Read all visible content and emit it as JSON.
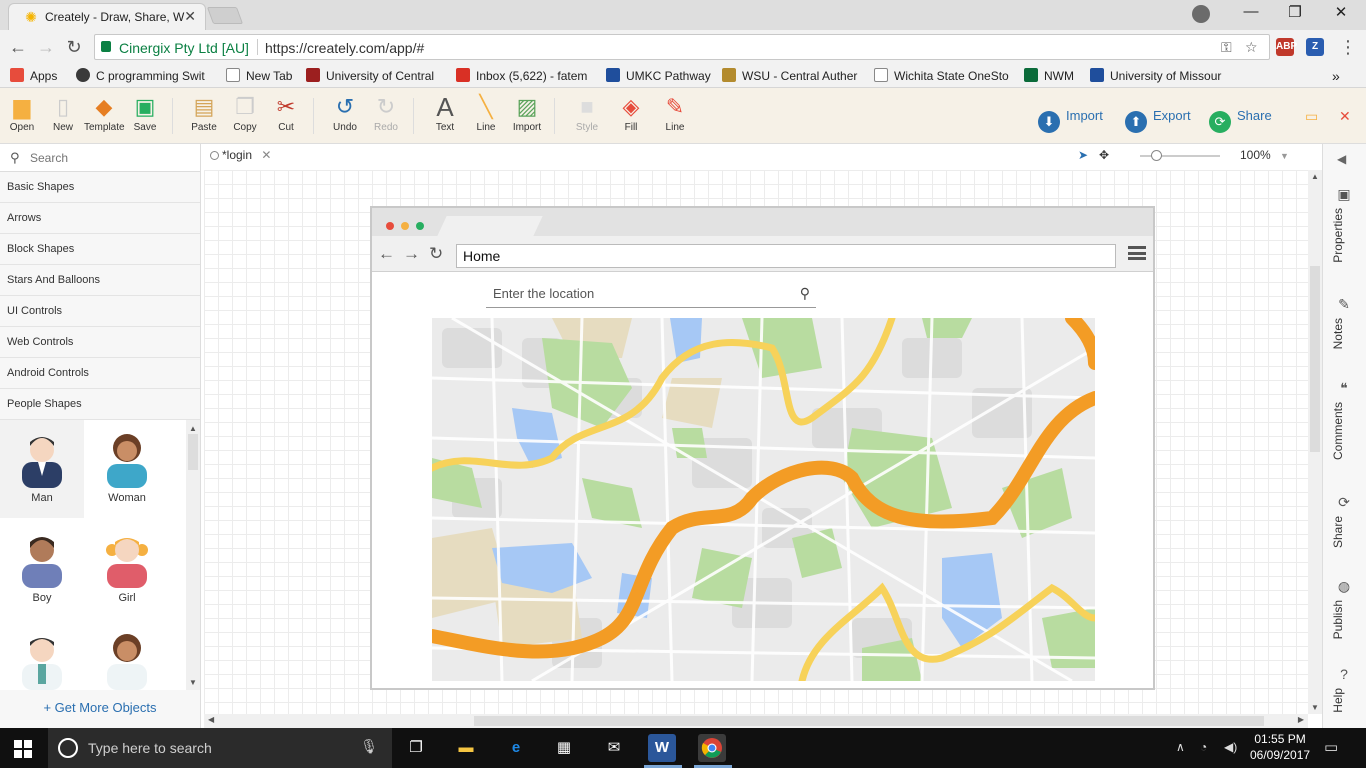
{
  "browser": {
    "tab_title": "Creately - Draw, Share, W",
    "site_owner": "Cinergix Pty Ltd [AU]",
    "url": "https://creately.com/app/#"
  },
  "bookmarks": [
    {
      "label": "Apps",
      "color": "#e74c3c"
    },
    {
      "label": "C programming Swit",
      "color": "#3a3a3a"
    },
    {
      "label": "New Tab",
      "color": "#888888"
    },
    {
      "label": "University of Central",
      "color": "#9c1f1f"
    },
    {
      "label": "Inbox (5,622) - fatem",
      "color": "#d93025"
    },
    {
      "label": "UMKC Pathway",
      "color": "#1f4e9c"
    },
    {
      "label": "WSU - Central Auther",
      "color": "#b38b2e"
    },
    {
      "label": "Wichita State OneSto",
      "color": "#888888"
    },
    {
      "label": "NWM",
      "color": "#0b6b3a"
    },
    {
      "label": "University of Missour",
      "color": "#1f4e9c"
    }
  ],
  "toolbar": {
    "open": "Open",
    "new": "New",
    "template": "Template",
    "save": "Save",
    "paste": "Paste",
    "copy": "Copy",
    "cut": "Cut",
    "undo": "Undo",
    "redo": "Redo",
    "text": "Text",
    "line": "Line",
    "import_img": "Import",
    "style": "Style",
    "fill": "Fill",
    "line_style": "Line",
    "import": "Import",
    "export": "Export",
    "share": "Share"
  },
  "library": {
    "search_placeholder": "Search",
    "categories": [
      "Basic Shapes",
      "Arrows",
      "Block Shapes",
      "Stars And Balloons",
      "UI Controls",
      "Web Controls",
      "Android Controls",
      "People Shapes"
    ],
    "shapes": [
      "Man",
      "Woman",
      "Boy",
      "Girl"
    ],
    "get_more": "+ Get More Objects"
  },
  "canvas": {
    "doc_tab": "*login",
    "zoom": "100%"
  },
  "mock": {
    "address": "Home",
    "location_placeholder": "Enter the location"
  },
  "right_rail": [
    "Properties",
    "Notes",
    "Comments",
    "Share",
    "Publish",
    "Help"
  ],
  "taskbar": {
    "search_placeholder": "Type here to search",
    "time": "01:55 PM",
    "date": "06/09/2017"
  },
  "colors": {
    "accent": "#2a6fb0",
    "secure": "#0b8043",
    "toolbar_bg": "#f6f1e7",
    "map_road_major": "#f39c25",
    "map_road_minor": "#f7d25a",
    "map_park": "#b8dca0",
    "map_water": "#a6c8f5"
  }
}
